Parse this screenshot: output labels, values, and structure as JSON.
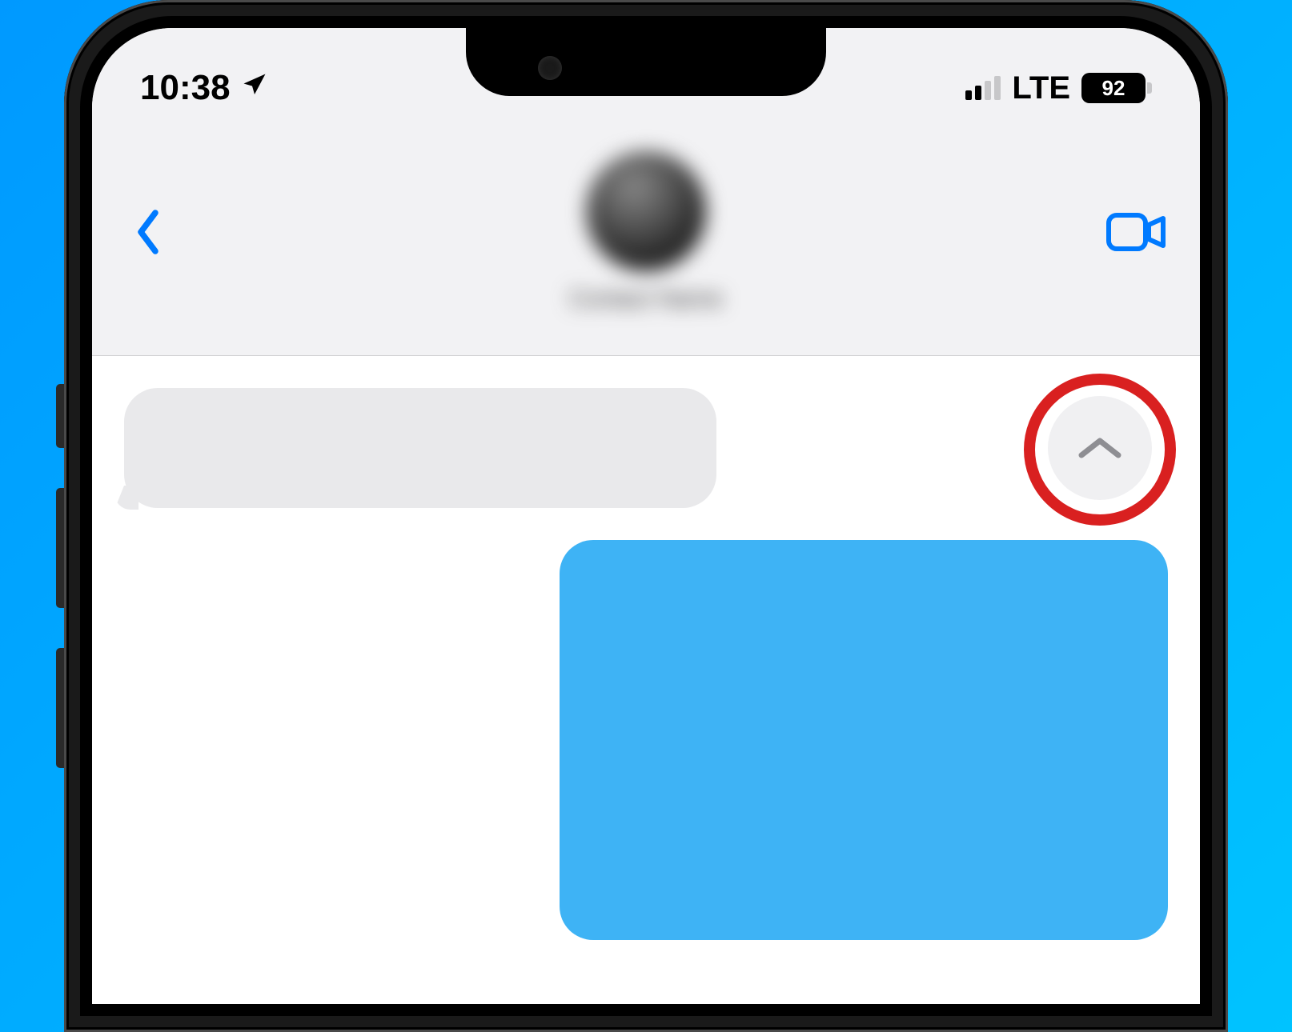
{
  "status_bar": {
    "time": "10:38",
    "signal_active_bars": 2,
    "network": "LTE",
    "battery_percent": "92"
  },
  "header": {
    "contact_name": "Contact Name"
  },
  "icons": {
    "back": "chevron-left",
    "video": "video-camera",
    "location": "location-arrow",
    "scroll_up": "chevron-up"
  },
  "colors": {
    "accent": "#007aff",
    "sent_bubble": "#3eb3f5",
    "received_bubble": "#e9e9eb",
    "highlight": "#d92020"
  }
}
